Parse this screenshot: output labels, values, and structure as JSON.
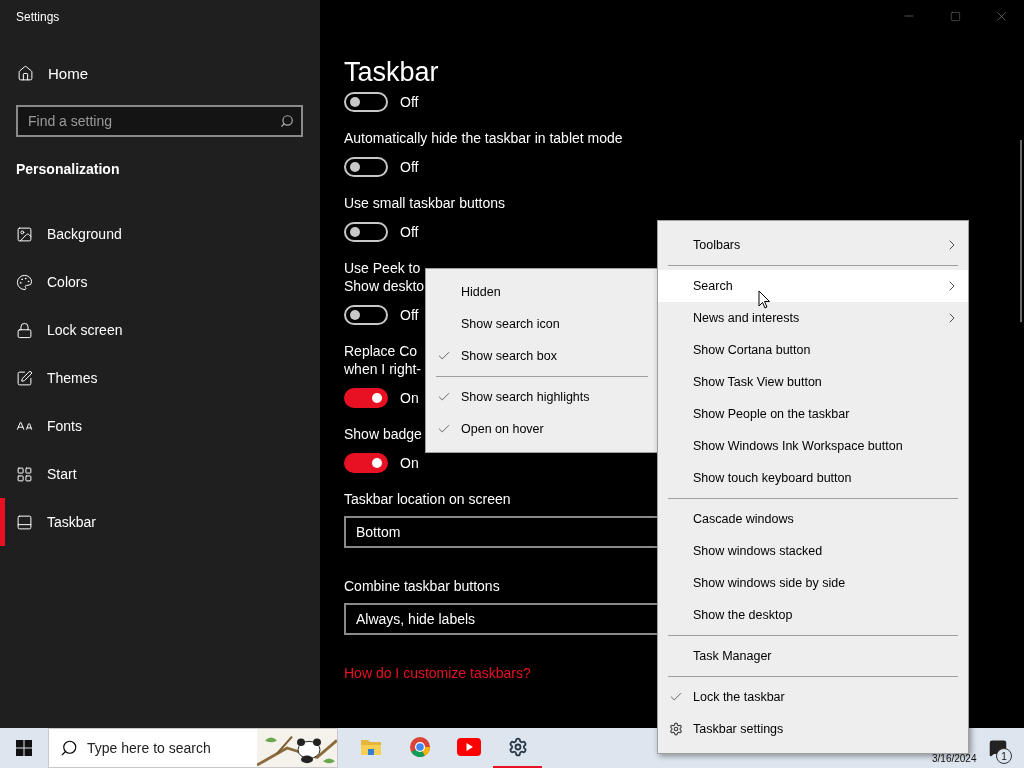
{
  "window": {
    "title": "Settings"
  },
  "sidebar": {
    "home": "Home",
    "search": {
      "placeholder": "Find a setting"
    },
    "section": "Personalization",
    "items": [
      {
        "label": "Background",
        "selected": false
      },
      {
        "label": "Colors",
        "selected": false
      },
      {
        "label": "Lock screen",
        "selected": false
      },
      {
        "label": "Themes",
        "selected": false
      },
      {
        "label": "Fonts",
        "selected": false
      },
      {
        "label": "Start",
        "selected": false
      },
      {
        "label": "Taskbar",
        "selected": true
      }
    ]
  },
  "content": {
    "title": "Taskbar",
    "settings": [
      {
        "kind": "toggle",
        "on": false,
        "state": "Off"
      },
      {
        "kind": "toggle",
        "lines": [
          "Automatically hide the taskbar in tablet mode"
        ],
        "on": false,
        "state": "Off"
      },
      {
        "kind": "toggle",
        "lines": [
          "Use small taskbar buttons"
        ],
        "on": false,
        "state": "Off"
      },
      {
        "kind": "toggle",
        "lines": [
          "Use Peek to",
          "Show deskto"
        ],
        "on": false,
        "state": "Off"
      },
      {
        "kind": "toggle",
        "lines": [
          "Replace Co",
          "when I right-"
        ],
        "on": true,
        "state": "On"
      },
      {
        "kind": "toggle",
        "lines": [
          "Show badge"
        ],
        "on": true,
        "state": "On"
      },
      {
        "kind": "dropdown",
        "label": "Taskbar location on screen",
        "value": "Bottom"
      },
      {
        "kind": "dropdown",
        "label": "Combine taskbar buttons",
        "value": "Always, hide labels"
      },
      {
        "kind": "link",
        "label": "How do I customize taskbars?"
      }
    ]
  },
  "search_submenu": {
    "items": [
      {
        "kind": "item",
        "label": "Hidden",
        "checked": false
      },
      {
        "kind": "item",
        "label": "Show search icon",
        "checked": false
      },
      {
        "kind": "item",
        "label": "Show search box",
        "checked": true
      },
      {
        "kind": "separator"
      },
      {
        "kind": "item",
        "label": "Show search highlights",
        "checked": true
      },
      {
        "kind": "item",
        "label": "Open on hover",
        "checked": true
      }
    ]
  },
  "context_menu": {
    "items": [
      {
        "kind": "item",
        "label": "Toolbars",
        "submenu": true,
        "checked": false,
        "selected": false
      },
      {
        "kind": "separator"
      },
      {
        "kind": "item",
        "label": "Search",
        "submenu": true,
        "checked": false,
        "selected": true
      },
      {
        "kind": "item",
        "label": "News and interests",
        "submenu": true,
        "checked": false,
        "selected": false
      },
      {
        "kind": "item",
        "label": "Show Cortana button",
        "submenu": false,
        "checked": false,
        "selected": false
      },
      {
        "kind": "item",
        "label": "Show Task View button",
        "submenu": false,
        "checked": false,
        "selected": false
      },
      {
        "kind": "item",
        "label": "Show People on the taskbar",
        "submenu": false,
        "checked": false,
        "selected": false
      },
      {
        "kind": "item",
        "label": "Show Windows Ink Workspace button",
        "submenu": false,
        "checked": false,
        "selected": false
      },
      {
        "kind": "item",
        "label": "Show touch keyboard button",
        "submenu": false,
        "checked": false,
        "selected": false
      },
      {
        "kind": "separator"
      },
      {
        "kind": "item",
        "label": "Cascade windows",
        "submenu": false,
        "checked": false,
        "selected": false
      },
      {
        "kind": "item",
        "label": "Show windows stacked",
        "submenu": false,
        "checked": false,
        "selected": false
      },
      {
        "kind": "item",
        "label": "Show windows side by side",
        "submenu": false,
        "checked": false,
        "selected": false
      },
      {
        "kind": "item",
        "label": "Show the desktop",
        "submenu": false,
        "checked": false,
        "selected": false
      },
      {
        "kind": "separator"
      },
      {
        "kind": "item",
        "label": "Task Manager",
        "submenu": false,
        "checked": false,
        "selected": false
      },
      {
        "kind": "separator"
      },
      {
        "kind": "item",
        "label": "Lock the taskbar",
        "submenu": false,
        "checked": true,
        "selected": false
      },
      {
        "kind": "gear-item",
        "label": "Taskbar settings",
        "submenu": false,
        "checked": false,
        "selected": false
      }
    ]
  },
  "taskbar": {
    "search": {
      "placeholder": "Type here to search"
    },
    "apps": [
      {
        "selected": false
      },
      {
        "selected": false
      },
      {
        "selected": false
      },
      {
        "selected": true
      }
    ],
    "date": "3/16/2024",
    "notifications": "1"
  }
}
